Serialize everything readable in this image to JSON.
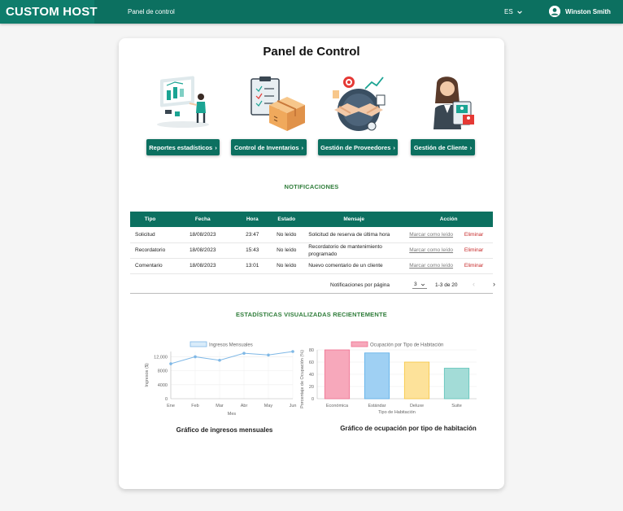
{
  "topbar": {
    "brand": "CUSTOM HOST",
    "nav_link": "Panel de control",
    "language": "ES",
    "user_name": "Winston Smith"
  },
  "page": {
    "title": "Panel de Control"
  },
  "tiles": [
    {
      "label": "Reportes estadísticos",
      "icon": "statistics-illustration"
    },
    {
      "label": "Control de Inventarios",
      "icon": "inventory-illustration"
    },
    {
      "label": "Gestión de Proveedores",
      "icon": "suppliers-illustration"
    },
    {
      "label": "Gestión de Cliente",
      "icon": "client-illustration"
    }
  ],
  "notifications": {
    "title": "NOTIFICACIONES",
    "headers": [
      "Tipo",
      "Fecha",
      "Hora",
      "Estado",
      "Mensaje",
      "Acción"
    ],
    "rows": [
      {
        "tipo": "Solicitud",
        "fecha": "18/08/2023",
        "hora": "23:47",
        "estado": "No leído",
        "mensaje": "Solicitud de reserva de última hora",
        "mark": "Marcar como leído",
        "delete": "Eliminar"
      },
      {
        "tipo": "Recordatorio",
        "fecha": "18/08/2023",
        "hora": "15:43",
        "estado": "No leído",
        "mensaje": "Recordatorio de mantenimiento programado",
        "mark": "Marcar como leído",
        "delete": "Eliminar"
      },
      {
        "tipo": "Comentario",
        "fecha": "18/08/2023",
        "hora": "13:01",
        "estado": "No leído",
        "mensaje": "Nuevo comentario de un cliente",
        "mark": "Marcar como leído",
        "delete": "Eliminar"
      }
    ],
    "pager": {
      "label": "Notificaciones por página",
      "per_page": "3",
      "range": "1-3 de 20"
    }
  },
  "stats": {
    "title": "ESTADÍSTICAS VISUALIZADAS RECIENTEMENTE"
  },
  "chart_data": [
    {
      "type": "line",
      "legend": "Ingresos Mensuales",
      "categories": [
        "Ene",
        "Feb",
        "Mar",
        "Abr",
        "May",
        "Jun"
      ],
      "values": [
        10000,
        12000,
        11000,
        13000,
        12500,
        13500
      ],
      "xlabel": "Mes",
      "ylabel": "Ingresos ($)",
      "yticks": [
        "0",
        "4000",
        "8000",
        "12,000"
      ],
      "ylim": [
        0,
        13500
      ],
      "color": "#7fb8e6",
      "caption": "Gráfico de ingresos mensuales"
    },
    {
      "type": "bar",
      "legend": "Ocupación por Tipo de Habitación",
      "categories": [
        "Económica",
        "Estándar",
        "Deluxe",
        "Suite"
      ],
      "values": [
        80,
        75,
        60,
        50
      ],
      "colors": [
        "#f7a8bb",
        "#9fd0f3",
        "#fde29a",
        "#a3dcd7"
      ],
      "borders": [
        "#ef6f8f",
        "#5aaee8",
        "#f5c542",
        "#5ec3b9"
      ],
      "xlabel": "Tipo de Habitación",
      "ylabel": "Porcentaje de Ocupación (%)",
      "yticks": [
        "0",
        "20",
        "40",
        "60",
        "80"
      ],
      "ylim": [
        0,
        80
      ],
      "caption": "Gráfico de ocupación por tipo de habitación"
    }
  ]
}
